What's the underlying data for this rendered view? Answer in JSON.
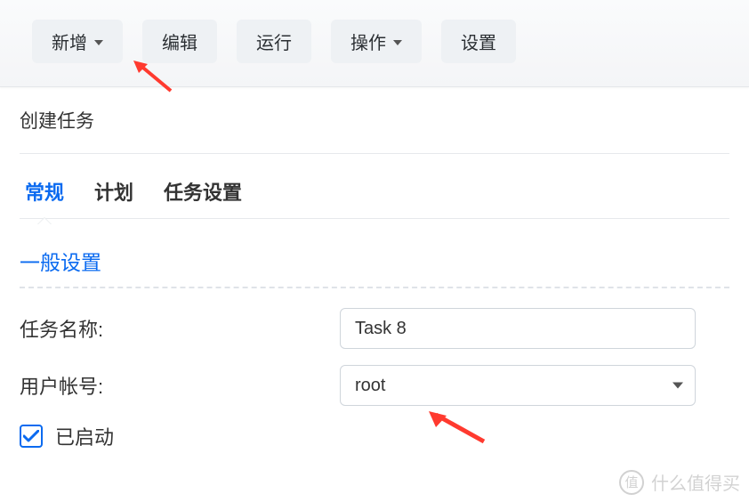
{
  "toolbar": {
    "add_label": "新增",
    "edit_label": "编辑",
    "run_label": "运行",
    "action_label": "操作",
    "settings_label": "设置"
  },
  "page_title": "创建任务",
  "tabs": {
    "general": "常规",
    "schedule": "计划",
    "task_settings": "任务设置"
  },
  "section": {
    "general_settings": "一般设置"
  },
  "form": {
    "task_name_label": "任务名称:",
    "task_name_value": "Task 8",
    "user_account_label": "用户帐号:",
    "user_account_value": "root",
    "enabled_label": "已启动"
  },
  "watermark": "什么值得买"
}
